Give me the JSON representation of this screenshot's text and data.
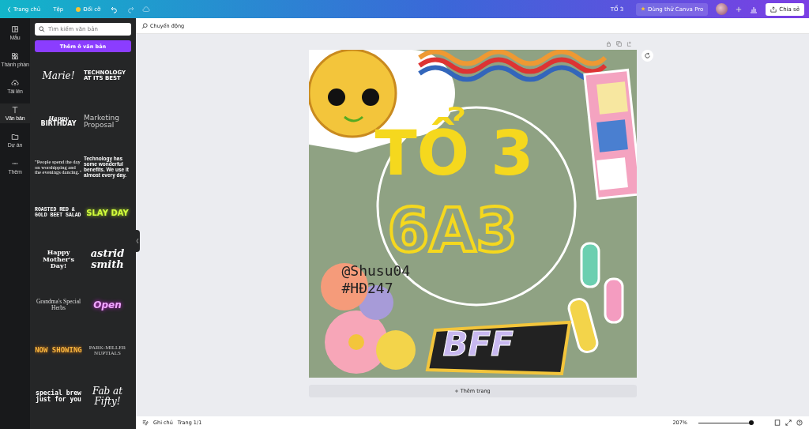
{
  "topbar": {
    "home": "Trang chủ",
    "file": "Tệp",
    "resize": "Đổi cỡ",
    "doc_title": "TỔ 3",
    "pro": "Dùng thử Canva Pro",
    "share": "Chia sẻ"
  },
  "rail": [
    {
      "label": "Mẫu",
      "selected": false
    },
    {
      "label": "Thành phần",
      "selected": false
    },
    {
      "label": "Tải lên",
      "selected": false
    },
    {
      "label": "Văn bản",
      "selected": true
    },
    {
      "label": "Dự án",
      "selected": false
    },
    {
      "label": "Thêm",
      "selected": false
    }
  ],
  "panel": {
    "search": {
      "placeholder": "Tìm kiếm văn bản"
    },
    "add_button": "Thêm ô văn bản",
    "templates": [
      {
        "kind": "script",
        "text": "Marie!"
      },
      {
        "kind": "bold",
        "text": "TECHNOLOGY AT ITS BEST"
      },
      {
        "kind": "birthday",
        "text": "Happy",
        "text2": "BIRTHDAY"
      },
      {
        "kind": "light",
        "text": "Marketing Proposal"
      },
      {
        "kind": "quote",
        "text": "\"People spend the day on worshipping and the evenings dancing.\""
      },
      {
        "kind": "para",
        "text": "Technology has some wonderful benefits. We use it almost every day."
      },
      {
        "kind": "mono",
        "text": "ROASTED RED & GOLD BEET SALAD"
      },
      {
        "kind": "neon-green",
        "text": "SLAY DAY"
      },
      {
        "kind": "serif",
        "text": "Happy Mother's Day!"
      },
      {
        "kind": "italic",
        "text": "astrid smith"
      },
      {
        "kind": "serif-light",
        "text": "Grandma's Special Herbs"
      },
      {
        "kind": "neon-pink",
        "text": "Open"
      },
      {
        "kind": "neon-orange",
        "text": "NOW SHOWING"
      },
      {
        "kind": "caps",
        "text": "PARK-MILLER NUPTIALS"
      },
      {
        "kind": "brew",
        "text": "special brew just for you"
      },
      {
        "kind": "script",
        "text": "Fab at Fifty!"
      }
    ]
  },
  "toolbar": {
    "animate": "Chuyển động"
  },
  "design": {
    "title": "TỔ 3",
    "subtitle": "6A3",
    "handle": "@Shusu04",
    "tag": "#HĐ247",
    "sticker": "BFF"
  },
  "add_page": "+ Thêm trang",
  "bottom": {
    "notes": "Ghi chú",
    "page": "Trang 1/1",
    "zoom": "207%",
    "level": 0.95
  }
}
